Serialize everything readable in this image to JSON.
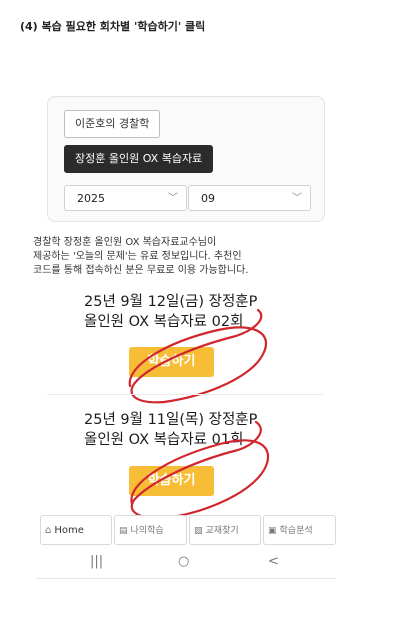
{
  "instruction": "(4) 복습 필요한 회차별 '학습하기' 클릭",
  "filters": {
    "professor_chip": "이준호의 경찰학",
    "material_chip": "장정훈 올인원 OX 복습자료",
    "year_value": "2025",
    "month_value": "09"
  },
  "notice": {
    "lines": [
      "경찰학 장정훈 올인원 OX 복습자료교수님이",
      "제공하는 '오늘의 문제'는 유료 정보입니다. 추천인",
      "코드를 통해 접속하신 분은 무료로 이용 가능합니다."
    ]
  },
  "items": [
    {
      "title_line1": "25년 9월 12일(금)   장정훈P",
      "title_line2": "올인원 OX 복습자료 02회",
      "button": "학습하기"
    },
    {
      "title_line1": "25년 9월 11일(목)   장정훈P",
      "title_line2": "올인원 OX 복습자료 01회",
      "button": "학습하기"
    }
  ],
  "bottom_nav": {
    "home": "Home",
    "my_study": "나의학습",
    "textbook": "교재찾기",
    "analysis": "학습분석"
  },
  "system_nav": {
    "recents": "|||",
    "home": "○",
    "back": "<"
  },
  "colors": {
    "study_button": "#f7bd36",
    "annotation_circle": "#d0262e",
    "dark_chip": "#2b2b2b"
  }
}
